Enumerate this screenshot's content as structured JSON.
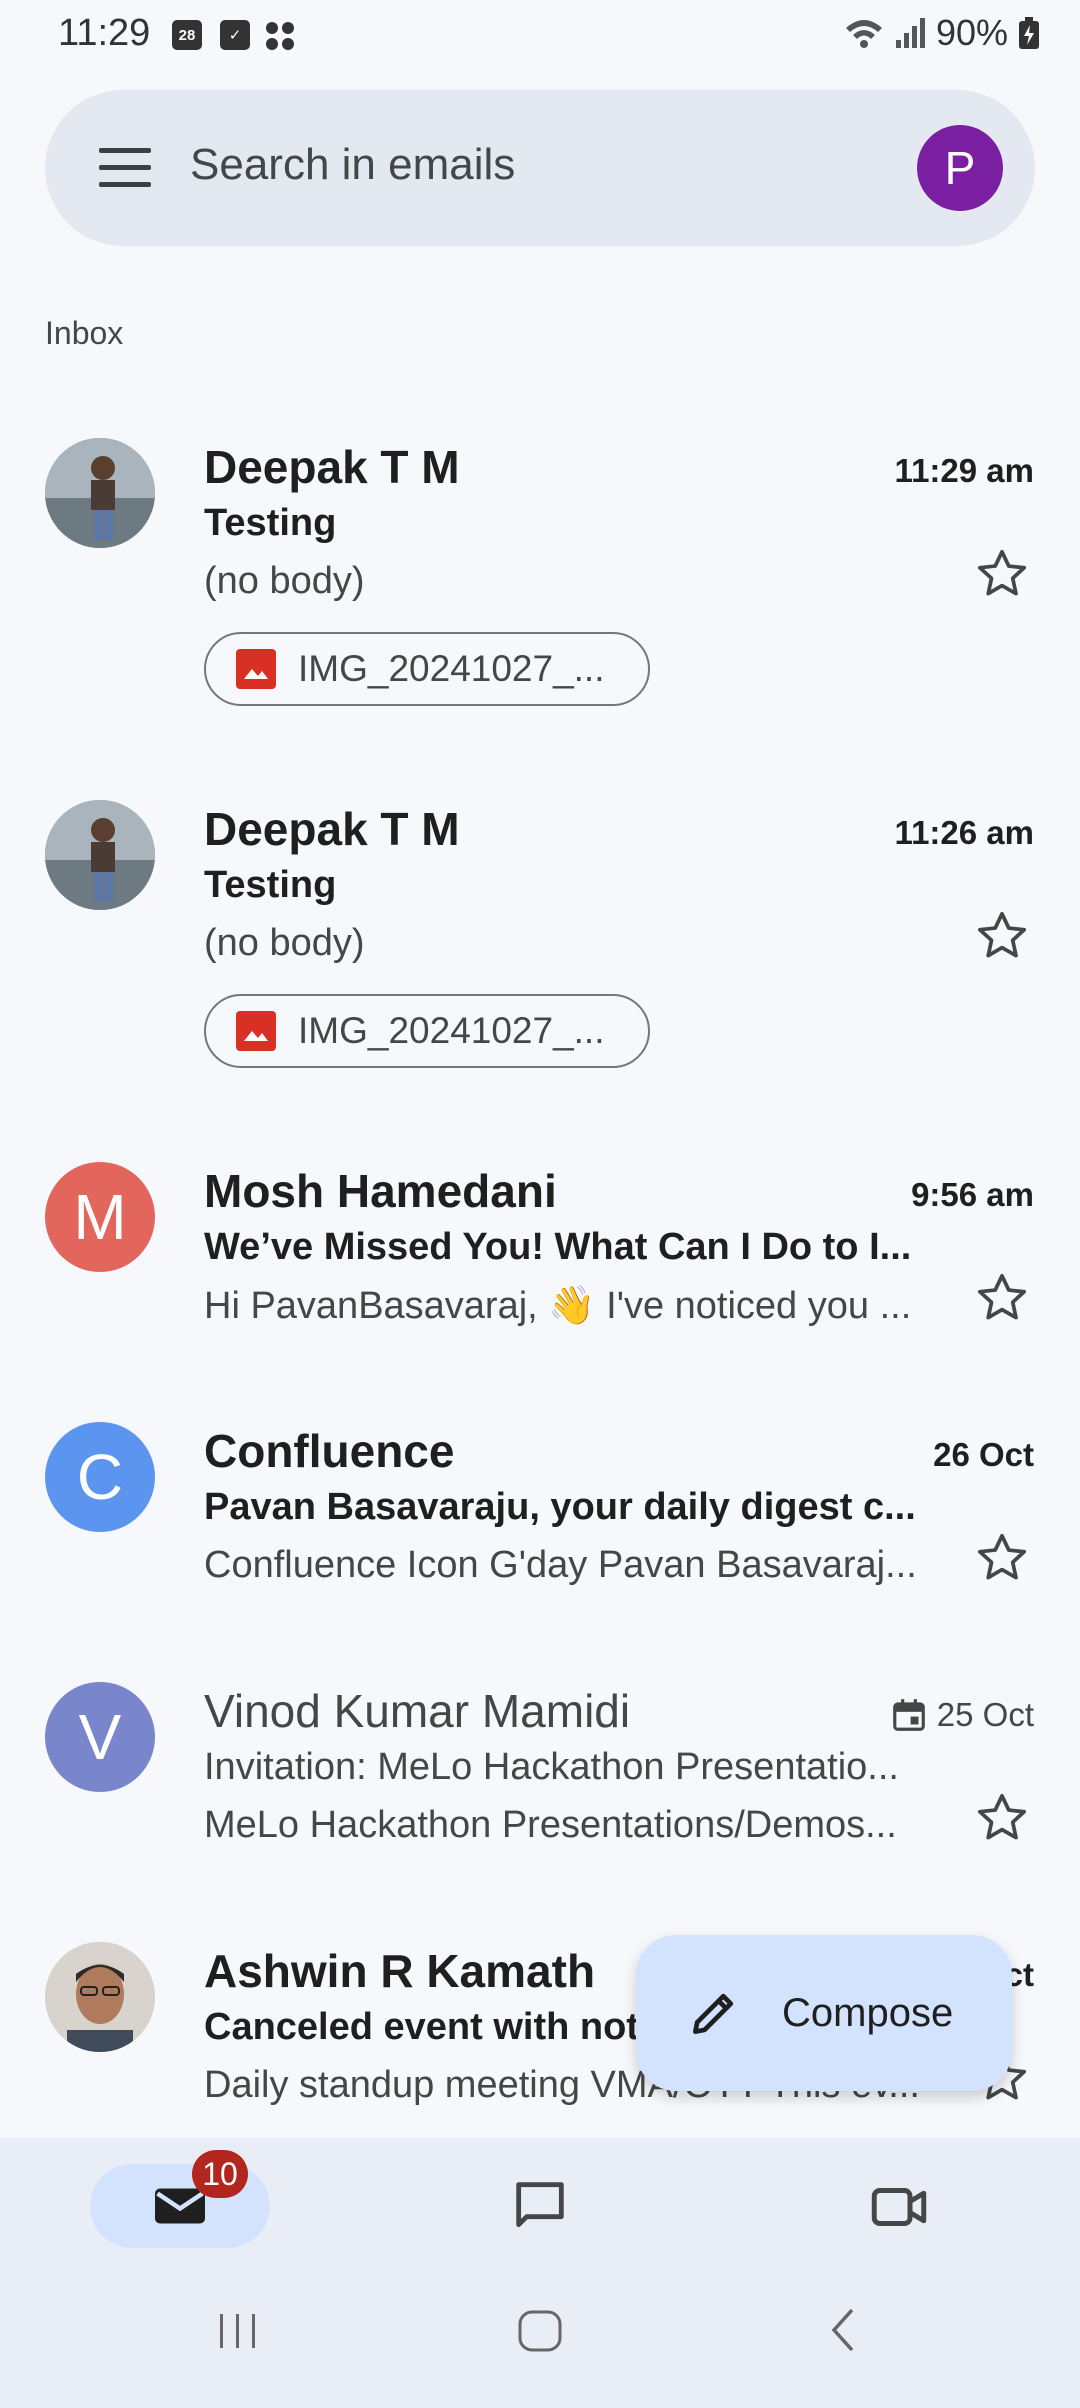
{
  "status_bar": {
    "time": "11:29",
    "calendar_day": "28",
    "battery": "90%"
  },
  "search": {
    "placeholder": "Search in emails",
    "avatar_letter": "P"
  },
  "inbox_label": "Inbox",
  "emails": [
    {
      "sender": "Deepak T M",
      "time": "11:29 am",
      "subject": "Testing",
      "snippet": "(no body)",
      "attachment": "IMG_20241027_...",
      "unread": true,
      "avatar": "photo",
      "starred": false
    },
    {
      "sender": "Deepak T M",
      "time": "11:26 am",
      "subject": "Testing",
      "snippet": "(no body)",
      "attachment": "IMG_20241027_...",
      "unread": true,
      "avatar": "photo",
      "starred": false
    },
    {
      "sender": "Mosh Hamedani",
      "time": "9:56 am",
      "subject": "We’ve Missed You! What Can I Do to I...",
      "snippet": "Hi PavanBasavaraj, 👋 I've noticed you ...",
      "unread": true,
      "avatar_letter": "M",
      "avatar_color": "#e2665b",
      "starred": false
    },
    {
      "sender": "Confluence",
      "time": "26 Oct",
      "subject": "Pavan Basavaraju, your daily digest c...",
      "snippet": "Confluence Icon G'day Pavan Basavaraj...",
      "unread": true,
      "avatar_letter": "C",
      "avatar_color": "#5b95f0",
      "starred": false
    },
    {
      "sender": "Vinod Kumar Mamidi",
      "time": "25 Oct",
      "subject": "Invitation: MeLo Hackathon Presentatio...",
      "snippet": "MeLo Hackathon Presentations/Demos...",
      "unread": false,
      "avatar_letter": "V",
      "avatar_color": "#7986cb",
      "starred": false,
      "calendar_icon": true
    },
    {
      "sender": "Ashwin R Kamath",
      "time": "25 Oct",
      "subject": "Canceled event with note",
      "snippet": "Daily standup meeting VMA/OTT This ev...",
      "unread": true,
      "avatar": "photo",
      "starred": false
    }
  ],
  "compose": {
    "label": "Compose"
  },
  "bottom_nav": {
    "mail_badge": "10",
    "items": [
      "mail-icon",
      "chat-icon",
      "meet-icon"
    ]
  },
  "colors": {
    "background": "#f6f8fc",
    "compose": "#d3e3fd",
    "badge": "#b3261e"
  }
}
